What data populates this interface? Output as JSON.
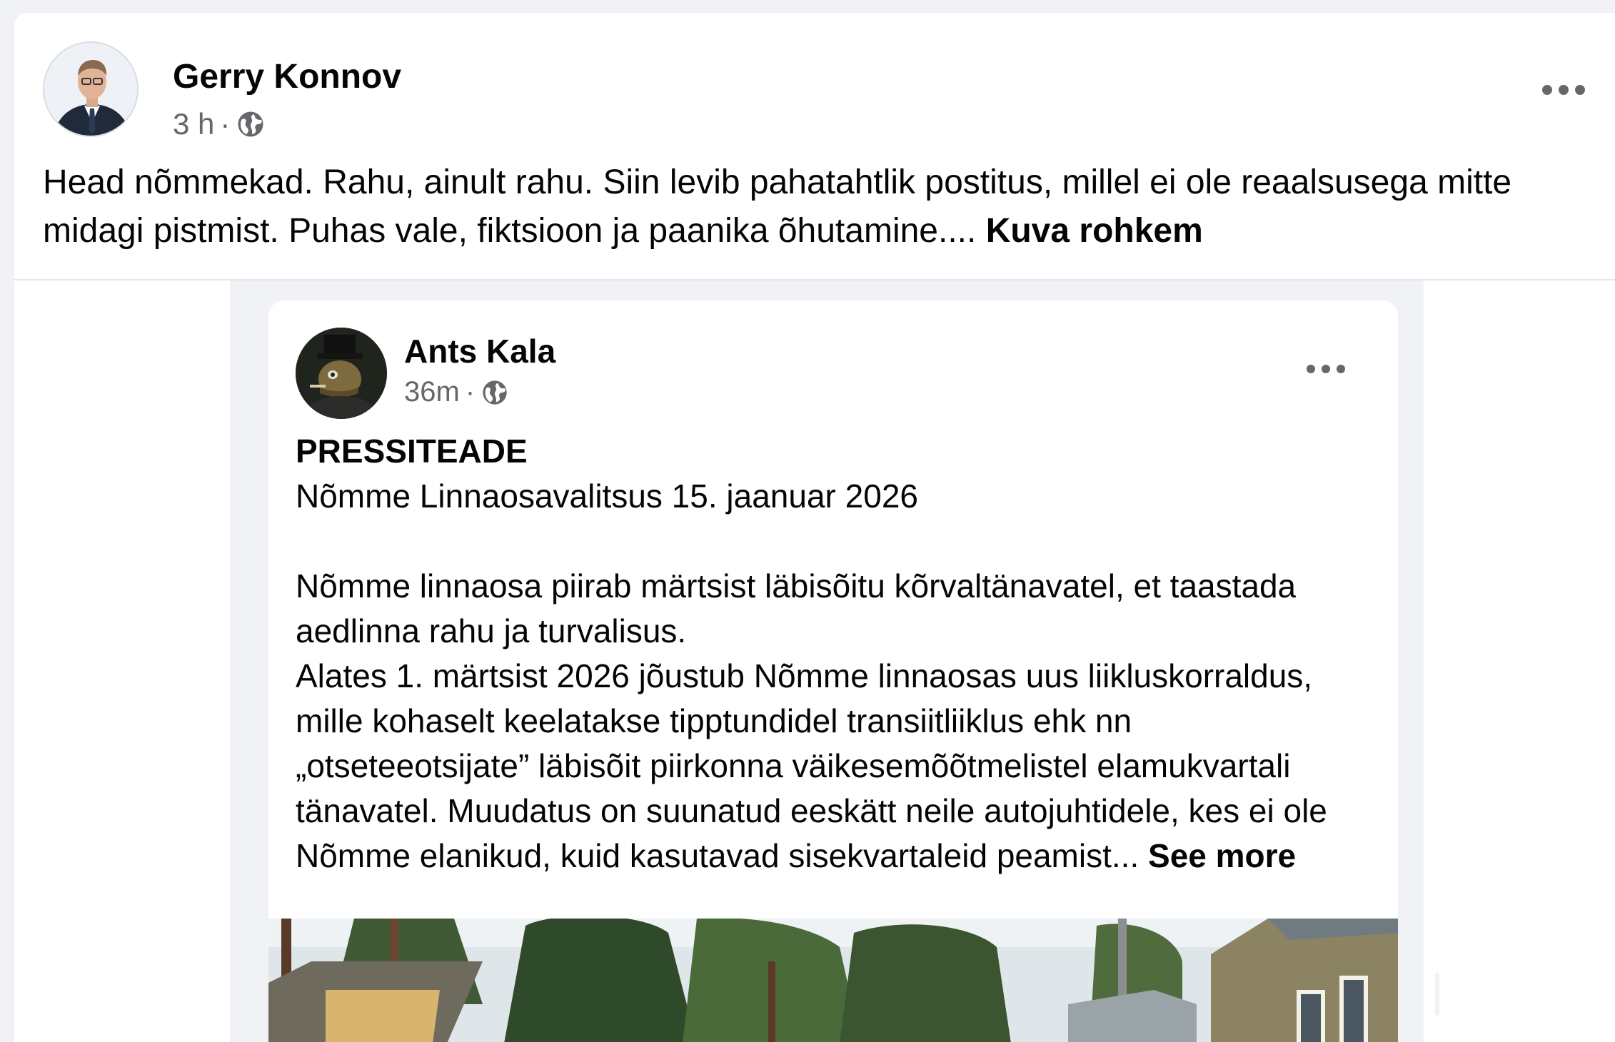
{
  "post": {
    "author": "Gerry Konnov",
    "time": "3 h",
    "separator": "·",
    "audience_icon": "globe-icon",
    "more_icon": "more-options-icon",
    "text": "Head nõmmekad. Rahu, ainult rahu. Siin levib pahatahtlik postitus, millel ei ole reaalsusega mitte midagi pistmist. Puhas vale, fiktsioon ja paanika õhutamine....",
    "see_more": "Kuva rohkem"
  },
  "shared_post": {
    "author": "Ants Kala",
    "time": "36m",
    "separator": "·",
    "audience_icon": "globe-icon",
    "title": "PRESSITEADE",
    "subtitle": "Nõmme Linnaosavalitsus 15. jaanuar 2026",
    "body": "Nõmme linnaosa piirab märtsist läbisõitu kõrvaltänavatel, et taastada aedlinna rahu ja turvalisus.",
    "body2": "Alates 1. märtsist 2026 jõustub Nõmme linnaosas uus liikluskorraldus, mille kohaselt keelatakse tipptundidel transiitliiklus ehk nn „otseteeotsijate” läbisõit piirkonna väikesemõõtmelistel elamukvartali tänavatel. Muudatus on suunatud eeskätt neile autojuhtidele, kes ei ole Nõmme elanikud, kuid kasutavad sisekvartaleid peamist...",
    "see_more": "See more"
  },
  "colors": {
    "background": "#f0f2f5",
    "card": "#ffffff",
    "text": "#050505",
    "secondary_text": "#65676b"
  }
}
